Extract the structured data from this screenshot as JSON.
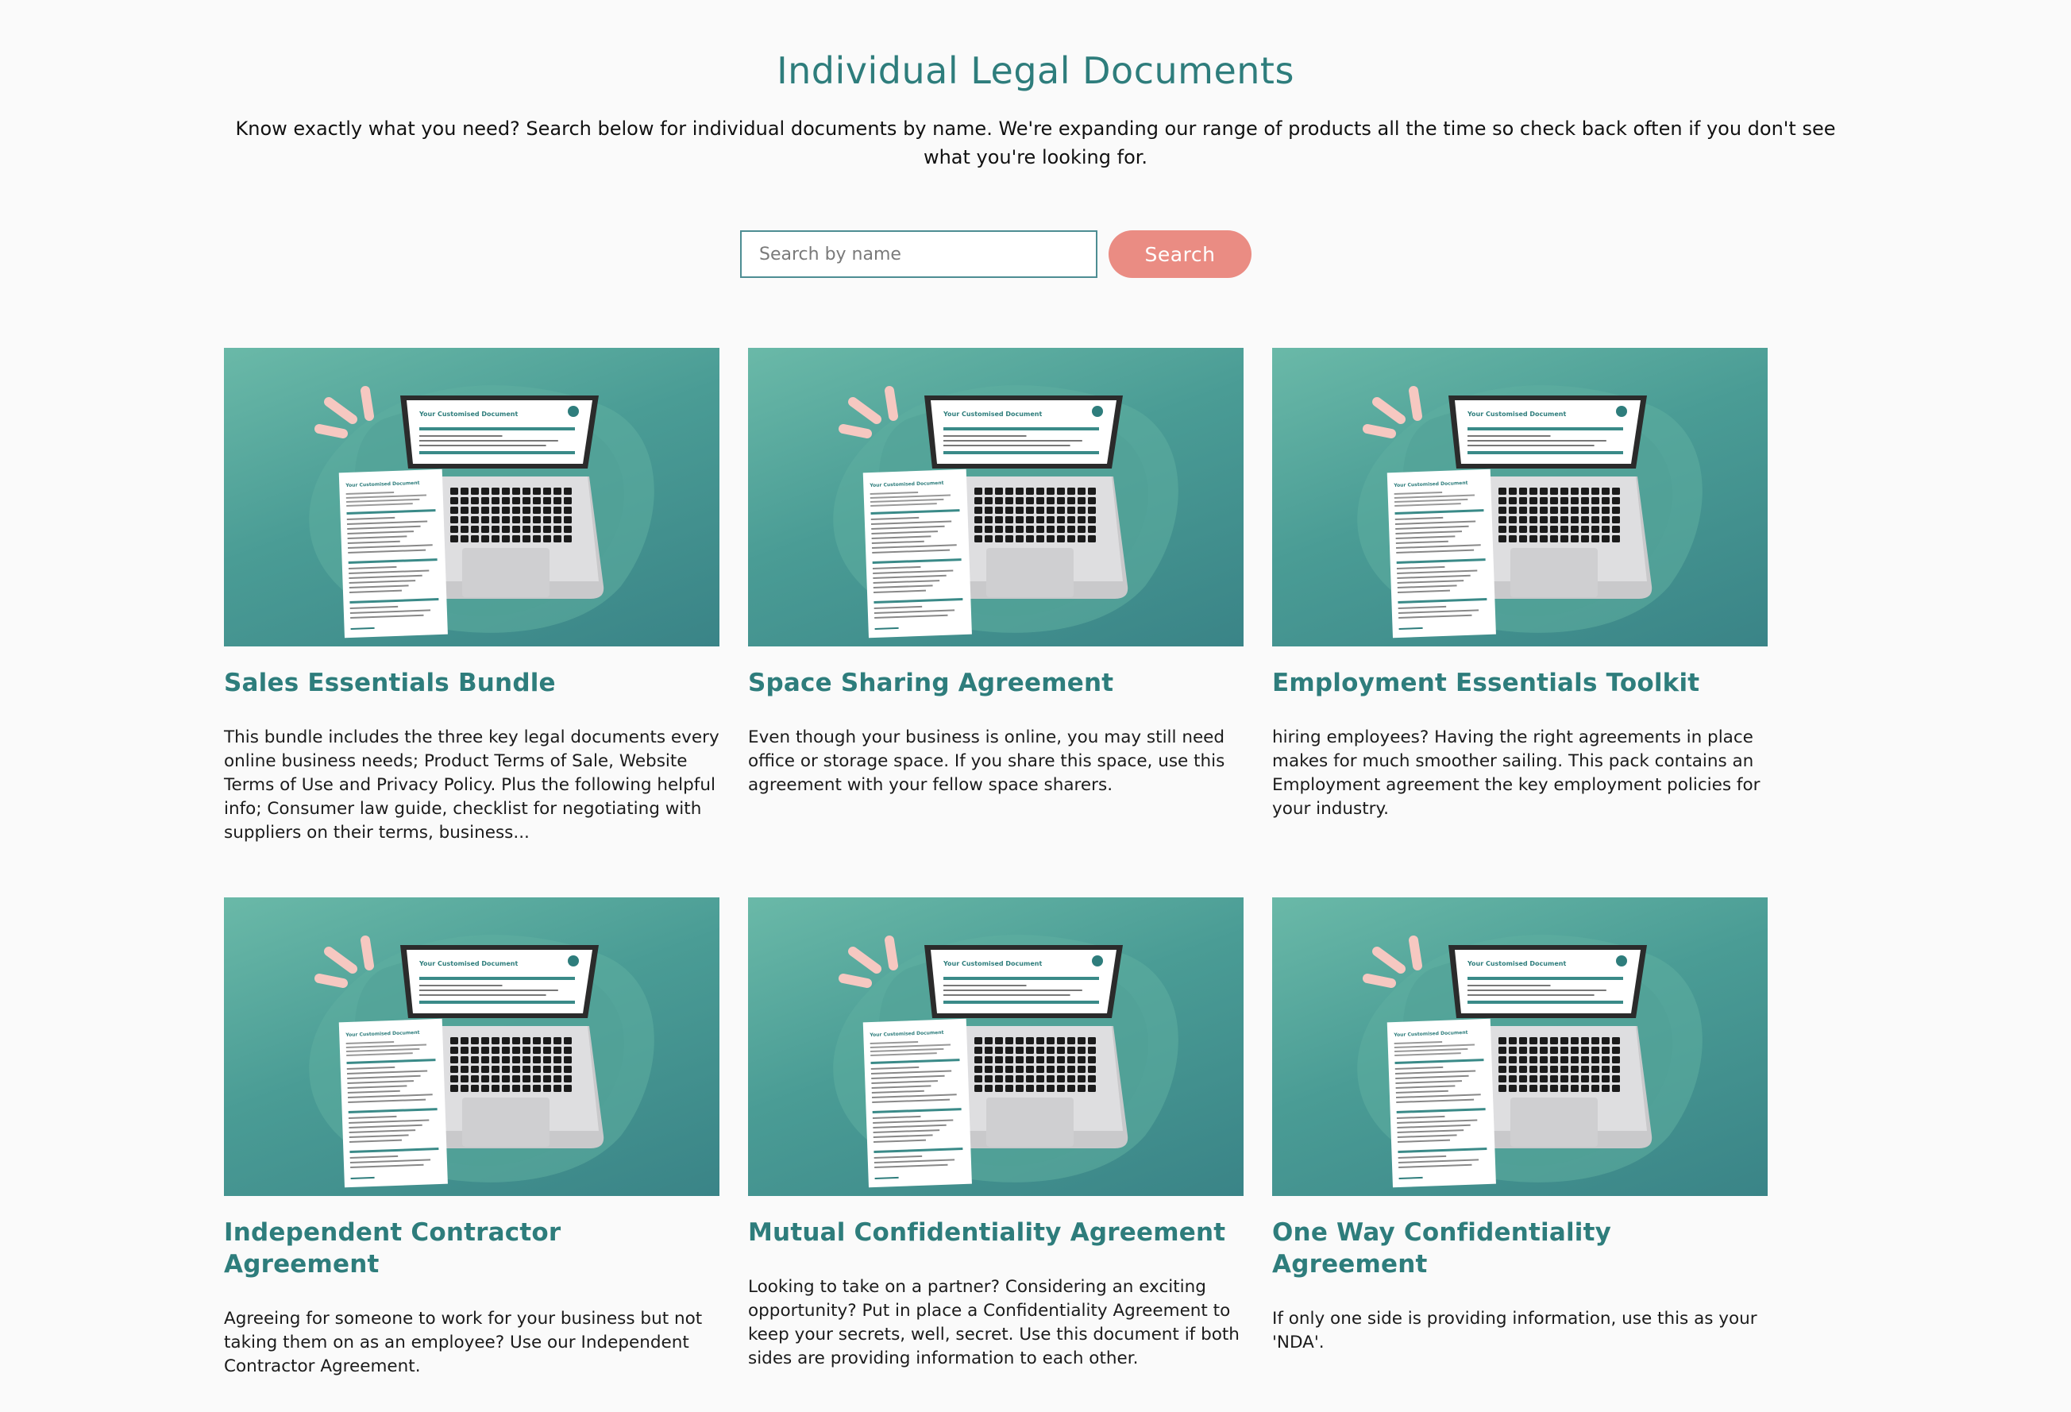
{
  "header": {
    "title": "Individual Legal Documents",
    "intro": "Know exactly what you need? Search below for individual documents by name. We're expanding our range of products all the time so check back often if you don't see what you're looking for."
  },
  "search": {
    "placeholder": "Search by name",
    "value": "",
    "button_label": "Search"
  },
  "colors": {
    "accent": "#2e7d7c",
    "button": "#ea8c83",
    "thumb_bg": "#4a9c95"
  },
  "thumbnail": {
    "doc_heading": "Your Customised Document",
    "icon": "laptop-document-illustration"
  },
  "products": [
    {
      "title": "Sales Essentials Bundle",
      "description": "This bundle includes the three key legal documents every online business needs; Product Terms of Sale, Website Terms of Use and Privacy Policy. Plus the following helpful info; Consumer law guide, checklist for negotiating with suppliers on their terms, business..."
    },
    {
      "title": "Space Sharing Agreement",
      "description": "Even though your business is online, you may still need office or storage space. If you share this space, use this agreement with your fellow space sharers."
    },
    {
      "title": "Employment Essentials Toolkit",
      "description": "hiring employees? Having the right agreements in place makes for much smoother sailing. This pack contains an Employment agreement the key employment policies for your industry."
    },
    {
      "title": "Independent Contractor Agreement",
      "description": "Agreeing for someone to work for your business but not taking them on as an employee? Use our Independent Contractor Agreement."
    },
    {
      "title": "Mutual Confidentiality Agreement",
      "description": "Looking to take on a partner? Considering an exciting opportunity? Put in place a Confidentiality Agreement to keep your secrets, well, secret. Use this document if both sides are providing information to each other."
    },
    {
      "title": "One Way Confidentiality Agreement",
      "description": "If only one side is providing information, use this as your 'NDA'."
    }
  ]
}
